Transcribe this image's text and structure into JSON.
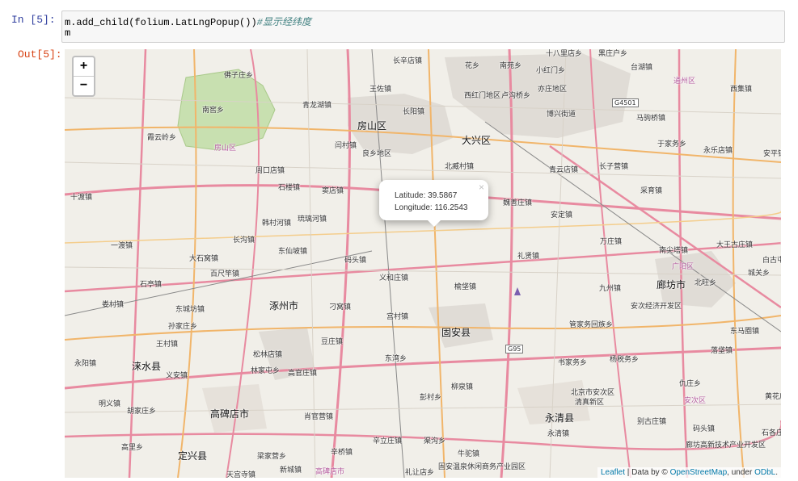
{
  "notebook": {
    "in_prompt": "In  [5]:",
    "out_prompt": "Out[5]:",
    "code_line1_code": "m.add_child(folium.LatLngPopup())",
    "code_line1_comment": "#显示经纬度",
    "code_line2": "m"
  },
  "map": {
    "zoom_in": "+",
    "zoom_out": "−",
    "popup": {
      "close": "×",
      "latitude": "Latitude: 39.5867",
      "longitude": "Longitude: 116.2543"
    },
    "attribution": {
      "leaflet": "Leaflet",
      "sep1": " | Data by © ",
      "osm": "OpenStreetMap",
      "sep2": ", under ",
      "odbl": "ODbL",
      "end": "."
    },
    "labels": [
      "长辛店镇",
      "花乡",
      "南苑乡",
      "小红门乡",
      "十八里店乡",
      "黑庄户乡",
      "台湖镇",
      "通州区",
      "西集镇",
      "佛子庄乡",
      "王佐镇",
      "卢沟桥乡",
      "亦庄地区",
      "马驹桥镇",
      "张家湾镇",
      "南窖乡",
      "青龙湖镇",
      "长阳镇",
      "西红门地区",
      "瀛海镇",
      "博兴街道",
      "于家务乡",
      "永乐店镇",
      "霞云岭乡",
      "房山区",
      "大兴区",
      "闫村镇",
      "良乡地区",
      "周口店镇",
      "北臧村镇",
      "青云店镇",
      "长子营镇",
      "采育镇",
      "十渡镇",
      "石楼镇",
      "窦店镇",
      "魏善庄镇",
      "安定镇",
      "韩村河镇",
      "琉璃河镇",
      "长沟镇",
      "万庄镇",
      "南尖塔镇",
      "大王古庄镇",
      "一渡镇",
      "大石窝镇",
      "东仙坡镇",
      "码头镇",
      "礼贤镇",
      "广阳区",
      "白古屯",
      "百尺竿镇",
      "义和庄镇",
      "榆垡镇",
      "九州镇",
      "廊坊市",
      "北旺乡",
      "城关乡",
      "石亭镇",
      "娄村镇",
      "涿州市",
      "刁窝镇",
      "宫村镇",
      "安次经济开发区",
      "东城坊镇",
      "孙家庄乡",
      "管家务回族乡",
      "东马圈镇",
      "王村镇",
      "豆庄镇",
      "固安县",
      "松林店镇",
      "东湾乡",
      "书家务乡",
      "杨税务乡",
      "落垡镇",
      "永阳镇",
      "涞水县",
      "义安镇",
      "林家屯乡",
      "高官庄镇",
      "柳泉镇",
      "北京市安次区",
      "清真新区",
      "仇庄乡",
      "黄花店",
      "明义镇",
      "彭村乡",
      "胡家庄乡",
      "安次区",
      "高碑店市",
      "肖官营镇",
      "牛驼镇",
      "永清县",
      "别古庄镇",
      "码头镇",
      "石各庄",
      "永清镇",
      "廊坊高新技术产业开发区",
      "高里乡",
      "辛立庄镇",
      "渠沟乡",
      "定兴县",
      "梁家营乡",
      "辛桥镇",
      "固安温泉休闲商务产业园区",
      "新城镇",
      "天宫寺镇",
      "高碑店市",
      "礼让店乡",
      "房山区",
      "安平镇"
    ],
    "road_shields": [
      "G4501",
      "G95"
    ]
  }
}
